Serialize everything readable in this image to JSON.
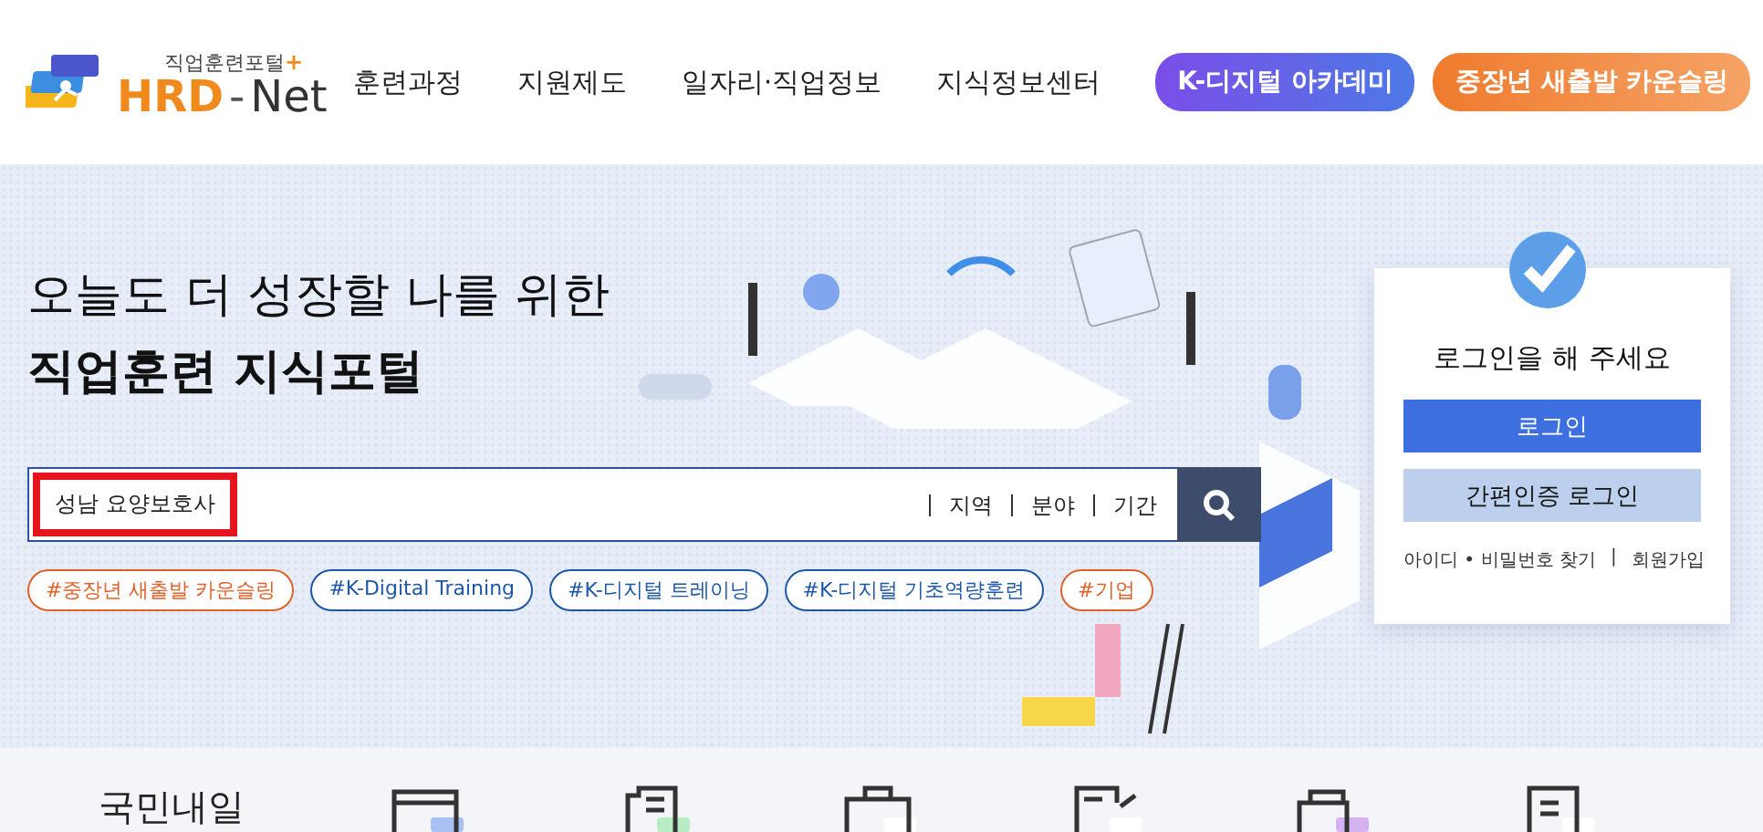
{
  "header": {
    "logo": {
      "tagline": "직업훈련포털",
      "plus": "+",
      "brand_a": "HRD",
      "dash": "-",
      "brand_b": "Net"
    },
    "nav": [
      {
        "label": "훈련과정",
        "kind": "link"
      },
      {
        "label": "지원제도",
        "kind": "link"
      },
      {
        "label": "일자리·직업정보",
        "kind": "link"
      },
      {
        "label": "지식정보센터",
        "kind": "link"
      },
      {
        "label": "K-디지털 아카데미",
        "kind": "purple"
      },
      {
        "label": "중장년 새출발 카운슬링",
        "kind": "orange"
      }
    ]
  },
  "hero": {
    "title_line1": "오늘도 더 성장할 나를 위한",
    "title_line2": "직업훈련 지식포털",
    "search": {
      "value": "성남 요양보호사",
      "filters": [
        "지역",
        "분야",
        "기간"
      ]
    },
    "tags": [
      {
        "label": "#중장년 새출발 카운슬링",
        "color": "#e0602a"
      },
      {
        "label": "#K-Digital Training",
        "color": "#1f57a8"
      },
      {
        "label": "#K-디지털 트레이닝",
        "color": "#1f57a8"
      },
      {
        "label": "#K-디지털 기초역량훈련",
        "color": "#1f57a8"
      },
      {
        "label": "#기업",
        "color": "#e0602a"
      }
    ]
  },
  "login": {
    "prompt": "로그인을 해 주세요",
    "login_button": "로그인",
    "easy_login_button": "간편인증 로그인",
    "find_link": "아이디 • 비밀번호 찾기",
    "separator": "|",
    "join_link": "회원가입"
  },
  "bottom": {
    "heading": "국민내일"
  }
}
